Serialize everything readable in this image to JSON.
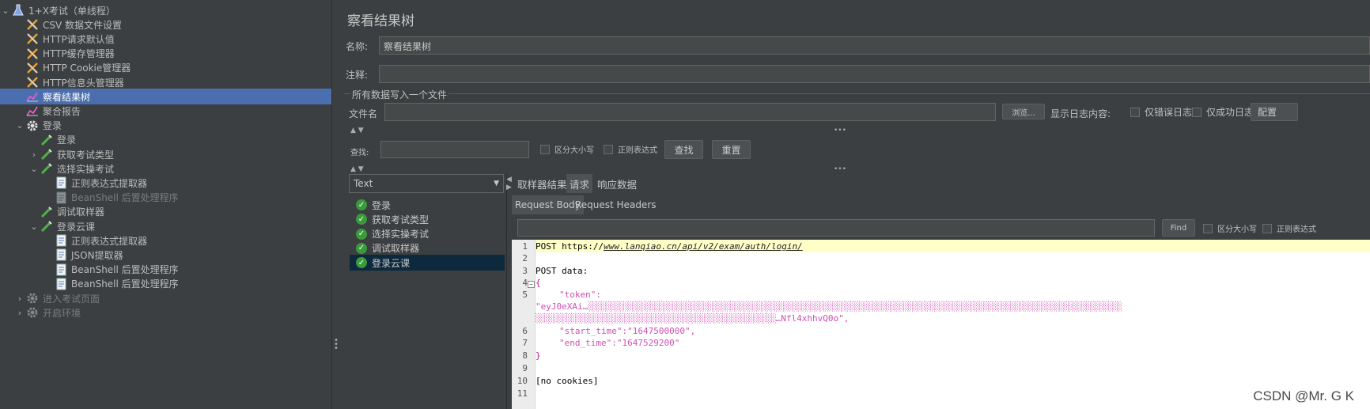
{
  "tree": {
    "items": [
      {
        "label": "1+X考试（单线程）",
        "icon": "flask-icon",
        "level": 0,
        "arrow": "⌄",
        "state": "normal"
      },
      {
        "label": "CSV 数据文件设置",
        "icon": "wrench-icon",
        "level": 1,
        "arrow": "",
        "state": "normal"
      },
      {
        "label": "HTTP请求默认值",
        "icon": "wrench-icon",
        "level": 1,
        "arrow": "",
        "state": "normal"
      },
      {
        "label": "HTTP缓存管理器",
        "icon": "wrench-icon",
        "level": 1,
        "arrow": "",
        "state": "normal"
      },
      {
        "label": "HTTP Cookie管理器",
        "icon": "wrench-icon",
        "level": 1,
        "arrow": "",
        "state": "normal"
      },
      {
        "label": "HTTP信息头管理器",
        "icon": "wrench-icon",
        "level": 1,
        "arrow": "",
        "state": "normal"
      },
      {
        "label": "察看结果树",
        "icon": "chart-icon",
        "level": 1,
        "arrow": "",
        "state": "selected"
      },
      {
        "label": "聚合报告",
        "icon": "chart-icon",
        "level": 1,
        "arrow": "",
        "state": "normal"
      },
      {
        "label": "登录",
        "icon": "gear-icon",
        "level": 1,
        "arrow": "⌄",
        "state": "normal"
      },
      {
        "label": "登录",
        "icon": "pipette-icon",
        "level": 2,
        "arrow": "",
        "state": "normal"
      },
      {
        "label": "获取考试类型",
        "icon": "pipette-icon",
        "level": 2,
        "arrow": "›",
        "state": "normal"
      },
      {
        "label": "选择实操考试",
        "icon": "pipette-icon",
        "level": 2,
        "arrow": "⌄",
        "state": "normal"
      },
      {
        "label": "正则表达式提取器",
        "icon": "document-icon",
        "level": 3,
        "arrow": "",
        "state": "normal"
      },
      {
        "label": "BeanShell 后置处理程序",
        "icon": "document-icon",
        "level": 3,
        "arrow": "",
        "state": "disabled"
      },
      {
        "label": "调试取样器",
        "icon": "pipette-icon",
        "level": 2,
        "arrow": "",
        "state": "normal"
      },
      {
        "label": "登录云课",
        "icon": "pipette-icon",
        "level": 2,
        "arrow": "⌄",
        "state": "normal"
      },
      {
        "label": "正则表达式提取器",
        "icon": "document-icon",
        "level": 3,
        "arrow": "",
        "state": "normal"
      },
      {
        "label": "JSON提取器",
        "icon": "document-icon",
        "level": 3,
        "arrow": "",
        "state": "normal"
      },
      {
        "label": "BeanShell 后置处理程序",
        "icon": "document-icon",
        "level": 3,
        "arrow": "",
        "state": "normal"
      },
      {
        "label": "BeanShell 后置处理程序",
        "icon": "document-icon",
        "level": 3,
        "arrow": "",
        "state": "normal"
      },
      {
        "label": "进入考试页面",
        "icon": "gear-icon",
        "level": 1,
        "arrow": "›",
        "state": "disabled"
      },
      {
        "label": "开启环境",
        "icon": "gear-icon",
        "level": 1,
        "arrow": "›",
        "state": "disabled"
      }
    ]
  },
  "panel": {
    "title": "察看结果树",
    "name_label": "名称:",
    "name_value": "察看结果树",
    "comment_label": "注释:",
    "comment_value": "",
    "file_section": "所有数据写入一个文件",
    "file_label": "文件名",
    "browse_label": "浏览...",
    "log_label": "显示日志内容:",
    "errors_only": "仅错误日志",
    "success_only": "仅成功日志",
    "config_label": "配置",
    "search_label": "查找:",
    "case_sensitive": "区分大小写",
    "regex": "正则表达式",
    "find_button": "查找",
    "reset_button": "重置"
  },
  "results": {
    "renderer": "Text",
    "items": [
      "登录",
      "获取考试类型",
      "选择实操考试",
      "调试取样器",
      "登录云课"
    ],
    "selected_index": 4
  },
  "tabs": {
    "main": [
      "取样器结果",
      "请求",
      "响应数据"
    ],
    "main_active": 1,
    "sub": [
      "Request Body",
      "Request Headers"
    ],
    "sub_active": 0
  },
  "find_bar": {
    "find_button": "Find",
    "case_sensitive": "区分大小写",
    "regex": "正则表达式"
  },
  "code": {
    "line_numbers": [
      "1",
      "2",
      "3",
      "4",
      "5",
      "",
      "",
      "6",
      "7",
      "8",
      "9",
      "10",
      "11"
    ],
    "line1_prefix": "POST https://",
    "line1_url": "www.lanqiao.cn/api/v2/exam/auth/login/",
    "line3": "POST data:",
    "line4": "{",
    "line5_key": "\"token\":",
    "line5_value_a": "\"eyJ0eXAi…",
    "line5_value_b": "…Nfl4xhhvQ0o\",",
    "line6": "\"start_time\":\"1647500000\",",
    "line7": "\"end_time\":\"1647529200\"",
    "line8": "}",
    "line10": "[no cookies]"
  },
  "watermark": "CSDN @Mr. G K"
}
